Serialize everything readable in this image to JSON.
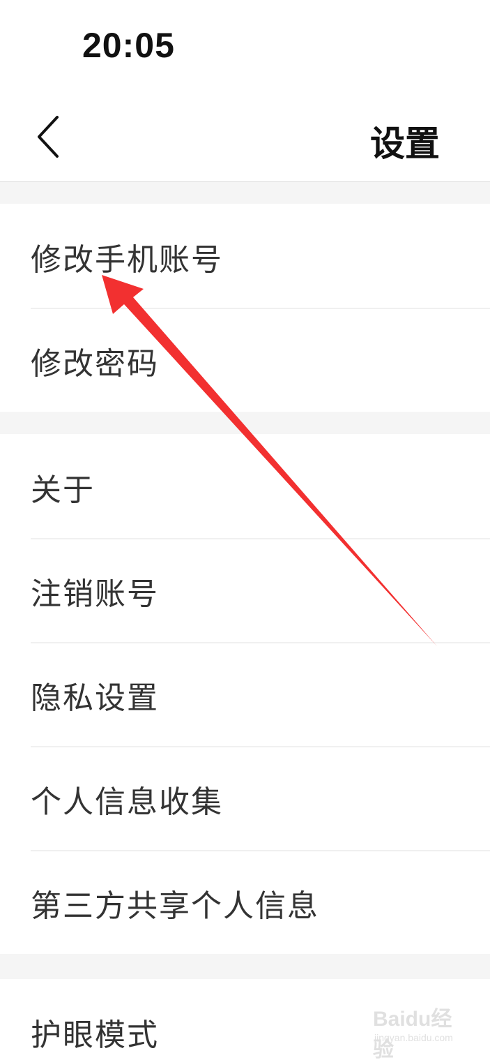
{
  "status_bar": {
    "time": "20:05"
  },
  "nav": {
    "title": "设置"
  },
  "sections": [
    {
      "items": [
        {
          "label": "修改手机账号"
        },
        {
          "label": "修改密码"
        }
      ]
    },
    {
      "items": [
        {
          "label": "关于"
        },
        {
          "label": "注销账号"
        },
        {
          "label": "隐私设置"
        },
        {
          "label": "个人信息收集"
        },
        {
          "label": "第三方共享个人信息"
        }
      ]
    },
    {
      "items": [
        {
          "label": "护眼模式"
        }
      ]
    }
  ],
  "watermark": {
    "brand": "Baidu经验",
    "domain": "jingyan.baidu.com"
  },
  "colors": {
    "arrow": "#f23030",
    "background": "#ffffff",
    "separator": "#f5f5f5",
    "text": "#333333"
  },
  "icons": {
    "back": "chevron-left-icon"
  }
}
